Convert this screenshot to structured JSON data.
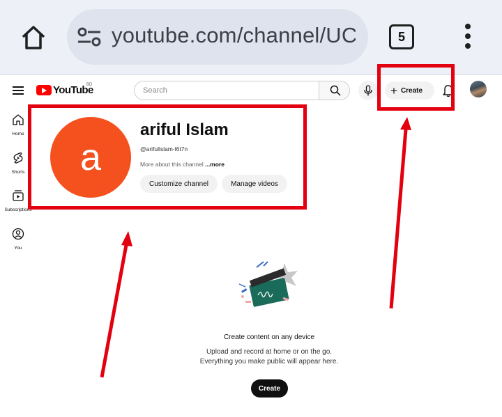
{
  "browser": {
    "url": "youtube.com/channel/UC",
    "tab_count": "5"
  },
  "header": {
    "logo_text": "YouTube",
    "country_code": "BD",
    "search_placeholder": "Search",
    "create_label": "Create"
  },
  "sidebar": {
    "items": [
      {
        "label": "Home",
        "icon": "home-icon"
      },
      {
        "label": "Shorts",
        "icon": "shorts-icon"
      },
      {
        "label": "Subscriptions",
        "icon": "subscriptions-icon"
      },
      {
        "label": "You",
        "icon": "you-icon"
      }
    ]
  },
  "channel": {
    "avatar_letter": "a",
    "avatar_color": "#f4511e",
    "name": "ariful Islam",
    "handle": "@arifullslam-l6t7n",
    "about": "More about this channel ",
    "about_more": "...more",
    "customize_label": "Customize channel",
    "manage_label": "Manage videos"
  },
  "empty_state": {
    "title": "Create content on any device",
    "line1": "Upload and record at home or on the go.",
    "line2": "Everything you make public will appear here.",
    "button_label": "Create"
  },
  "annotations": {
    "highlight_color": "#e3000f"
  }
}
